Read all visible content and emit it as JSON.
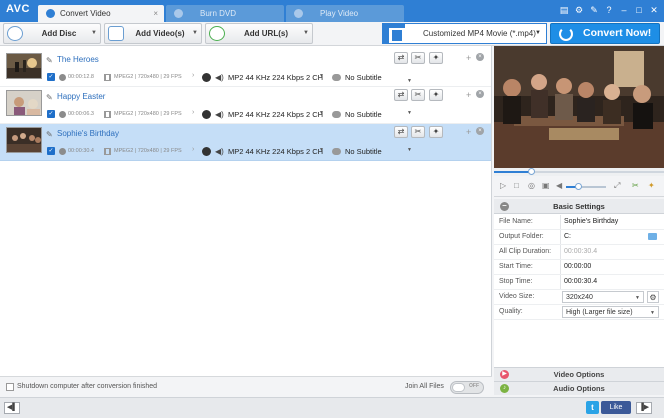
{
  "app": {
    "logo": "AVC",
    "tabs": [
      {
        "label": "Convert Video",
        "active": true,
        "icon": "convert-video-icon"
      },
      {
        "label": "Burn DVD",
        "active": false,
        "icon": "burn-dvd-icon"
      },
      {
        "label": "Play Video",
        "active": false,
        "icon": "play-video-icon"
      }
    ],
    "window_icons": [
      "menu-icon",
      "gear-icon",
      "key-icon",
      "help-icon",
      "minimize-icon",
      "maximize-icon",
      "close-icon"
    ]
  },
  "toolbar": {
    "add_disc": "Add Disc",
    "add_videos": "Add Video(s)",
    "add_urls": "Add URL(s)",
    "output_format": "Customized MP4 Movie (*.mp4)",
    "convert_now": "Convert Now!",
    "accent_color": "#2f7fd4"
  },
  "files": [
    {
      "name": "The Heroes",
      "checked": true,
      "duration": "00:00:12.8",
      "video_info": "MPEG2 | 720x480 | 29 FPS",
      "audio": "MP2 44 KHz 224 Kbps 2 CH",
      "subtitle": "No Subtitle",
      "selected": false
    },
    {
      "name": "Happy Easter",
      "checked": true,
      "duration": "00:00:06.3",
      "video_info": "MPEG2 | 720x480 | 29 FPS",
      "audio": "MP2 44 KHz 224 Kbps 2 CH",
      "subtitle": "No Subtitle",
      "selected": false
    },
    {
      "name": "Sophie's Birthday",
      "checked": true,
      "duration": "00:00:30.4",
      "video_info": "MPEG2 | 720x480 | 29 FPS",
      "audio": "MP2 44 KHz 224 Kbps 2 CH",
      "subtitle": "No Subtitle",
      "selected": true
    }
  ],
  "bottom": {
    "shutdown_label": "Shutdown computer after conversion finished",
    "join_label": "Join All Files",
    "join_toggle": "OFF"
  },
  "player": {
    "seek_progress": 0.22,
    "volume_level": 0.3
  },
  "settings": {
    "header": "Basic Settings",
    "rows": [
      {
        "label": "File Name:",
        "value": "Sophie's Birthday"
      },
      {
        "label": "Output Folder:",
        "value": "C:"
      },
      {
        "label": "All Clip Duration:",
        "value": "00:00:30.4"
      },
      {
        "label": "Start Time:",
        "value": "00:00:00"
      },
      {
        "label": "Stop Time:",
        "value": "00:00:30.4"
      },
      {
        "label": "Video Size:",
        "value": "320x240"
      },
      {
        "label": "Quality:",
        "value": "High (Larger file size)"
      }
    ]
  },
  "options": {
    "video": "Video Options",
    "audio": "Audio Options"
  },
  "status": {
    "twitter": "t",
    "like": "Like"
  }
}
